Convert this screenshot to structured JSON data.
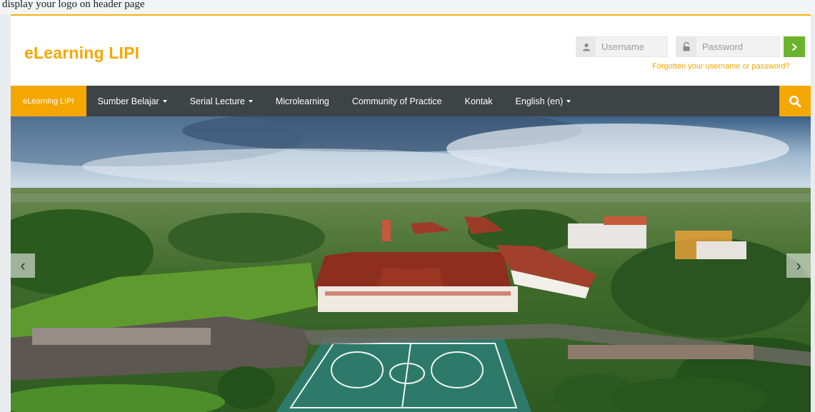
{
  "caption": "display your logo on header page",
  "brand": {
    "title": "eLearning LIPI"
  },
  "login": {
    "username_placeholder": "Username",
    "password_placeholder": "Password",
    "submit_icon": "chevron-right-icon",
    "forgot_text": "Forgotten your username or password?"
  },
  "nav": {
    "items": [
      {
        "label": "eLearning LIPI",
        "active": true,
        "dropdown": false
      },
      {
        "label": "Sumber Belajar",
        "dropdown": true
      },
      {
        "label": "Serial Lecture",
        "dropdown": true
      },
      {
        "label": "Microlearning",
        "dropdown": false
      },
      {
        "label": "Community of Practice",
        "dropdown": false
      },
      {
        "label": "Kontak",
        "dropdown": false
      },
      {
        "label": "English (en)",
        "dropdown": true
      }
    ],
    "search_icon": "search-icon"
  },
  "slider": {
    "prev_label": "‹",
    "next_label": "›",
    "image": "aerial view of campus buildings with red roofs, green fields and a basketball court"
  },
  "colors": {
    "accent": "#f4a700",
    "navbar": "#3e4346",
    "login_button": "#6ab42d"
  }
}
